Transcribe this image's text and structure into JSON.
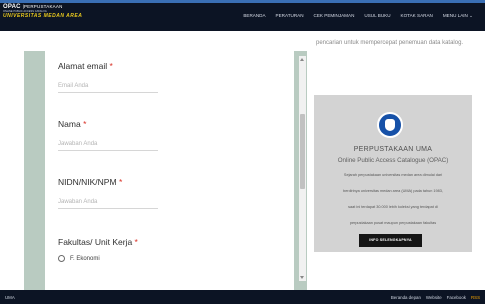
{
  "header": {
    "logo_main": "OPAC",
    "logo_sub": "PERPUSTAKAAN",
    "logo_tag": "ONLINE PUBLIC ACCESS CATALOG",
    "logo_university": "UNIVERSITAS MEDAN AREA",
    "nav": [
      "BERANDA",
      "PERATURAN",
      "CEK PEMINJAMAN",
      "USUL BUKU",
      "KOTAK SARAN",
      "MENU LAIN ⌄"
    ]
  },
  "form": {
    "fields": [
      {
        "label": "Alamat email",
        "required_mark": "*",
        "placeholder": "Email Anda"
      },
      {
        "label": "Nama",
        "required_mark": "*",
        "placeholder": "Jawaban Anda"
      },
      {
        "label": "NIDN/NIK/NPM",
        "required_mark": "*",
        "placeholder": "Jawaban Anda"
      }
    ],
    "fakultas": {
      "label": "Fakultas/ Unit Kerja",
      "required_mark": "*",
      "option": "F. Ekonomi"
    }
  },
  "sidebar": {
    "intro_text": "pencarian untuk mempercepat penemuan data katalog.",
    "card": {
      "title": "PERPUSTAKAAN UMA",
      "subtitle": "Online Public Access Catalogue (OPAC)",
      "lines": [
        "Sejarah perpustakaan universitas medan area dimulai dari",
        "berdirinya universitas medan area (UMA) pada tahun 1983,",
        "saat ini terdapat 30.000 lebih koleksi yang terdapat di",
        "perpustakaan pusat maupun perpustakaan fakultas"
      ],
      "button": "INFO SELENGKAPNYA"
    }
  },
  "footer": {
    "left": "UMA",
    "links": [
      "Beranda depan",
      "Website",
      "Facebook",
      "RSS"
    ]
  },
  "colors": {
    "header_bg": "#0c1424",
    "accent_blue": "#3a6fb5",
    "logo_yellow": "#e8c81e",
    "form_frame": "#b9cbc1",
    "required_red": "#d93025",
    "card_bg": "#d3d3d3",
    "button_bg": "#151515",
    "rss_orange": "#f2a200"
  }
}
